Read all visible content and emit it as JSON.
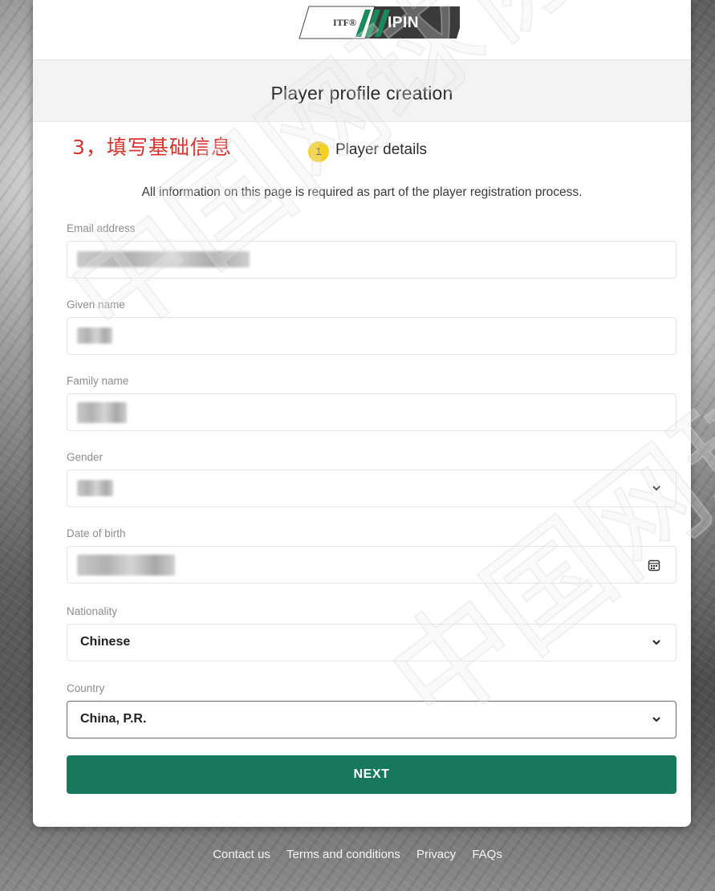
{
  "header": {
    "logo": {
      "itf_mark": "ITF®",
      "product": "IPIN"
    },
    "title": "Player profile creation"
  },
  "annotation": {
    "text": "3，填写基础信息",
    "color": "#d9322c"
  },
  "step": {
    "number": "1",
    "label": "Player details",
    "badge_color": "#f5cf22"
  },
  "info": "All information on this page is required as part of the player registration process.",
  "form": {
    "email": {
      "label": "Email address"
    },
    "given_name": {
      "label": "Given name"
    },
    "family_name": {
      "label": "Family name"
    },
    "gender": {
      "label": "Gender"
    },
    "date_of_birth": {
      "label": "Date of birth"
    },
    "nationality": {
      "label": "Nationality",
      "value": "Chinese"
    },
    "country": {
      "label": "Country",
      "value": "China, P.R."
    }
  },
  "next_button": {
    "label": "NEXT",
    "color": "#18785d"
  },
  "footer": {
    "links": [
      "Contact us",
      "Terms and conditions",
      "Privacy",
      "FAQs"
    ]
  },
  "watermark": {
    "text": "中国网球协会"
  },
  "icons": {
    "select_chevron": "chevron-down-icon",
    "date_picker": "calendar-icon"
  }
}
